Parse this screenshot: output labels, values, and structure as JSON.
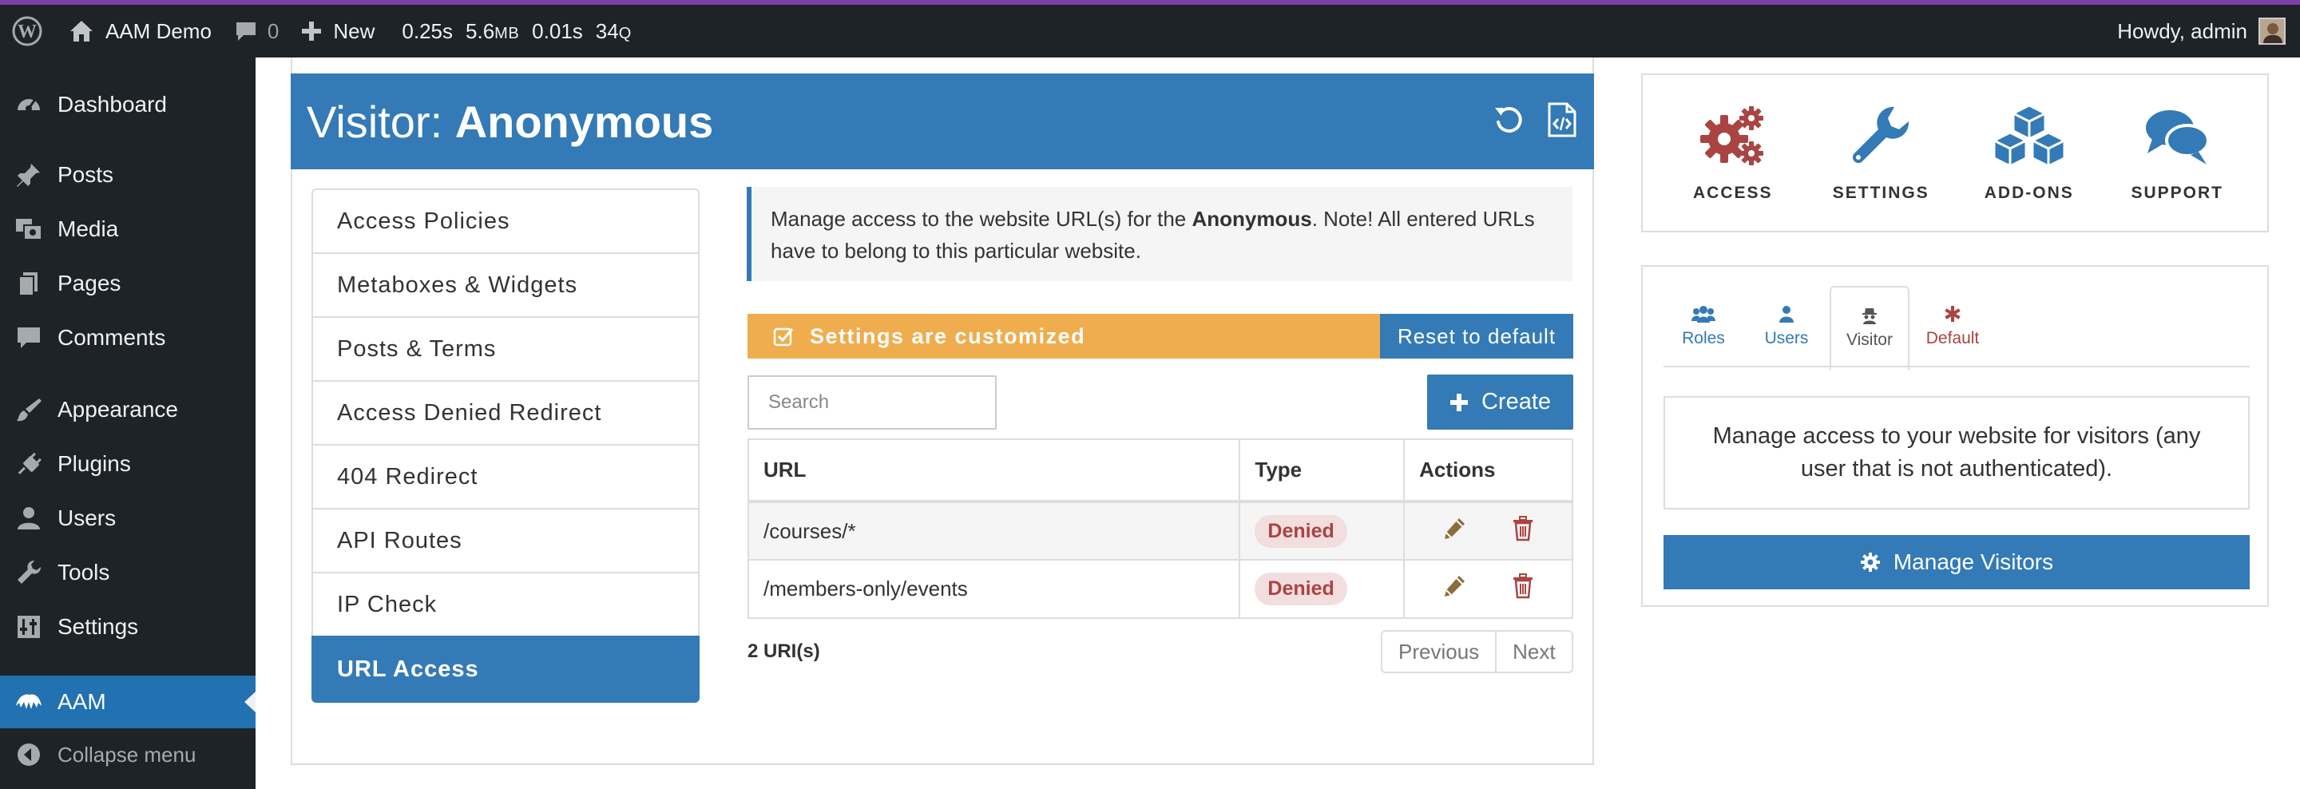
{
  "admin_bar": {
    "site_name": "AAM Demo",
    "comments_count": "0",
    "new_label": "New",
    "perf": {
      "time": "0.25s",
      "memory_value": "5.6",
      "memory_unit": "MB",
      "query_time": "0.01s",
      "query_count": "34",
      "query_unit": "Q"
    },
    "greeting": "Howdy, admin"
  },
  "sidebar": {
    "items": [
      {
        "label": "Dashboard",
        "icon": "dashboard-icon"
      },
      {
        "label": "Posts",
        "icon": "pin-icon"
      },
      {
        "label": "Media",
        "icon": "media-icon"
      },
      {
        "label": "Pages",
        "icon": "pages-icon"
      },
      {
        "label": "Comments",
        "icon": "comment-icon"
      },
      {
        "label": "Appearance",
        "icon": "brush-icon"
      },
      {
        "label": "Plugins",
        "icon": "plugin-icon"
      },
      {
        "label": "Users",
        "icon": "user-icon"
      },
      {
        "label": "Tools",
        "icon": "wrench-icon"
      },
      {
        "label": "Settings",
        "icon": "settings-icon"
      },
      {
        "label": "AAM",
        "icon": "aam-icon"
      }
    ],
    "collapse_label": "Collapse menu"
  },
  "header": {
    "prefix": "Visitor:",
    "subject": "Anonymous"
  },
  "nav": {
    "items": [
      "Access Policies",
      "Metaboxes & Widgets",
      "Posts & Terms",
      "Access Denied Redirect",
      "404 Redirect",
      "API Routes",
      "IP Check",
      "URL Access"
    ],
    "active": "URL Access"
  },
  "notice": {
    "before": "Manage access to the website URL(s) for the ",
    "subject": "Anonymous",
    "after": ". Note! All entered URLs have to belong to this particular website."
  },
  "settings_bar": {
    "message": "Settings are customized",
    "reset_label": "Reset to default"
  },
  "search": {
    "placeholder": "Search",
    "value": ""
  },
  "create_label": "Create",
  "table": {
    "headers": [
      "URL",
      "Type",
      "Actions"
    ],
    "rows": [
      {
        "url": "/courses/*",
        "type": "Denied"
      },
      {
        "url": "/members-only/events",
        "type": "Denied"
      }
    ]
  },
  "count_label": "2 URI(s)",
  "pagination": {
    "previous": "Previous",
    "next": "Next"
  },
  "top_links": [
    {
      "label": "ACCESS",
      "icon": "gears-icon"
    },
    {
      "label": "SETTINGS",
      "icon": "wrench-icon"
    },
    {
      "label": "ADD-ONS",
      "icon": "cubes-icon"
    },
    {
      "label": "SUPPORT",
      "icon": "chat-icon"
    }
  ],
  "subject_tabs": [
    {
      "label": "Roles",
      "icon": "group-icon"
    },
    {
      "label": "Users",
      "icon": "user-icon"
    },
    {
      "label": "Visitor",
      "icon": "visitor-icon"
    },
    {
      "label": "Default",
      "icon": "asterisk-icon"
    }
  ],
  "visitor_description": "Manage access to your website for visitors (any user that is not authenticated).",
  "manage_visitors_label": "Manage Visitors",
  "colors": {
    "primary": "#337ab7",
    "warning": "#f0ad4e",
    "danger": "#a94442",
    "admin_bar": "#1d2327",
    "edit_icon": "#8a6d3b"
  }
}
